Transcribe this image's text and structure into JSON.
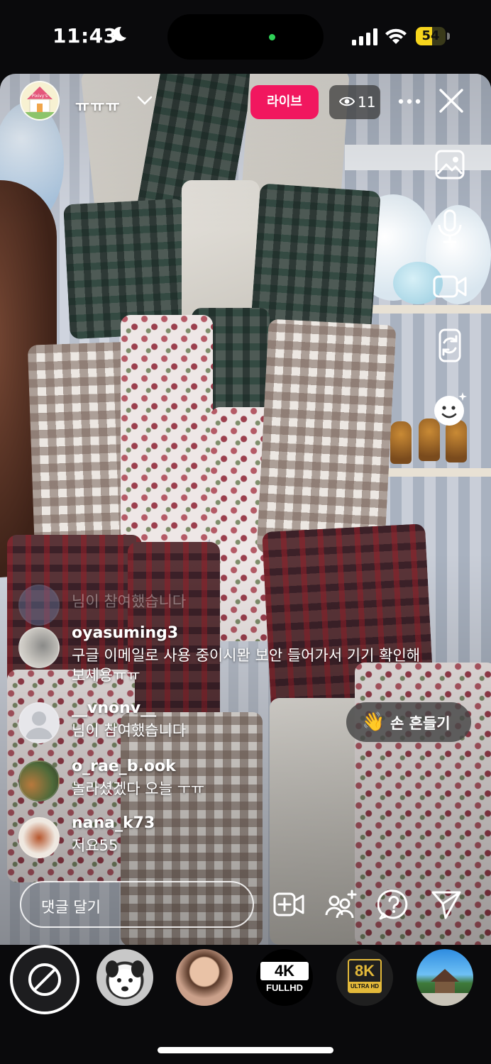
{
  "status_bar": {
    "time": "11:43",
    "battery": "54",
    "battery_level": 0.54,
    "icons": [
      "moon-icon",
      "signal-icon",
      "wifi-icon",
      "battery-icon"
    ]
  },
  "header": {
    "host_name": "ㅠㅠㅠ",
    "live_label": "라이브",
    "viewer_count": "11",
    "host_avatar_text": "Pixivy's"
  },
  "side_tools": [
    "image-icon",
    "microphone-icon",
    "video-camera-icon",
    "flip-camera-icon",
    "face-effects-icon"
  ],
  "comments": [
    {
      "user": "",
      "text": "님이 참여했습니다",
      "faded": true
    },
    {
      "user": "oyasuming3",
      "text": "구글 이메일로 사용 중이시뫈 보안 들어가서 기기 확인해보세용ㅠㅠ"
    },
    {
      "user": "__vnonv__",
      "text": "님이 참여했습니다"
    },
    {
      "user": "o_rae_b.ook",
      "text": "놀라셨겠다 오늘 ㅜㅠ"
    },
    {
      "user": "nana_k73",
      "text": "저요55"
    }
  ],
  "wave_button": {
    "label": "손 흔들기",
    "emoji": "👋"
  },
  "comment_input": {
    "placeholder": "댓글 달기"
  },
  "bottom_actions": [
    "add-video-icon",
    "add-guest-icon",
    "question-icon",
    "send-icon"
  ],
  "filters": [
    {
      "name": "no-filter"
    },
    {
      "name": "dog-filter"
    },
    {
      "name": "portrait-filter"
    },
    {
      "name": "4k-filter",
      "line1": "4K",
      "line2": "FULLHD"
    },
    {
      "name": "8k-filter",
      "line1": "8K",
      "line2": "ULTRA HD"
    },
    {
      "name": "landscape-filter"
    }
  ]
}
